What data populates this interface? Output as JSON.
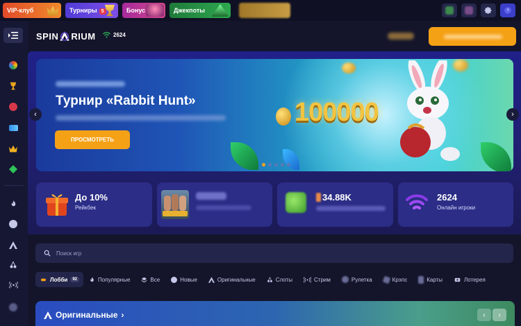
{
  "promos": {
    "vip": "VIP-клуб",
    "tournaments": "Турниры",
    "tournaments_badge": "5",
    "bonus": "Бонус",
    "jackpots": "Джекпоты"
  },
  "header": {
    "logo_left": "SPIN",
    "logo_right": "RIUM",
    "online_count": "2624"
  },
  "banner": {
    "title": "Турнир «Rabbit Hunt»",
    "button": "ПРОСМОТРЕТЬ",
    "prize": "100000",
    "slide_count": 5,
    "active_slide": 1
  },
  "cards": {
    "cashback_value": "До 10%",
    "cashback_label": "Рейкбек",
    "count_value": "34.88K",
    "online_value": "2624",
    "online_label": "Онлайн игроки"
  },
  "search": {
    "placeholder": "Поиск игр"
  },
  "categories": [
    {
      "label": "Лобби",
      "count": "92",
      "icon": "lobby-icon"
    },
    {
      "label": "Популярные",
      "icon": "flame-icon"
    },
    {
      "label": "Все",
      "icon": "layers-icon"
    },
    {
      "label": "Новые",
      "icon": "new-icon"
    },
    {
      "label": "Оригинальные",
      "icon": "spinarium-icon"
    },
    {
      "label": "Слоты",
      "icon": "cherries-icon"
    },
    {
      "label": "Стрим",
      "icon": "broadcast-icon"
    },
    {
      "label": "Рулетка",
      "icon": "roulette-icon"
    },
    {
      "label": "Крэпс",
      "icon": "dice-icon"
    },
    {
      "label": "Карты",
      "icon": "cards-icon"
    },
    {
      "label": "Лотерея",
      "icon": "lottery-icon"
    }
  ],
  "originals": {
    "title": "Оригинальные",
    "chevron": "›",
    "prev": "‹",
    "next": "›"
  },
  "arrows": {
    "prev": "‹",
    "next": "›"
  },
  "colors": {
    "accent": "#f5a116",
    "background": "#14152b",
    "panel": "#20218a",
    "card": "#2b2d86"
  }
}
